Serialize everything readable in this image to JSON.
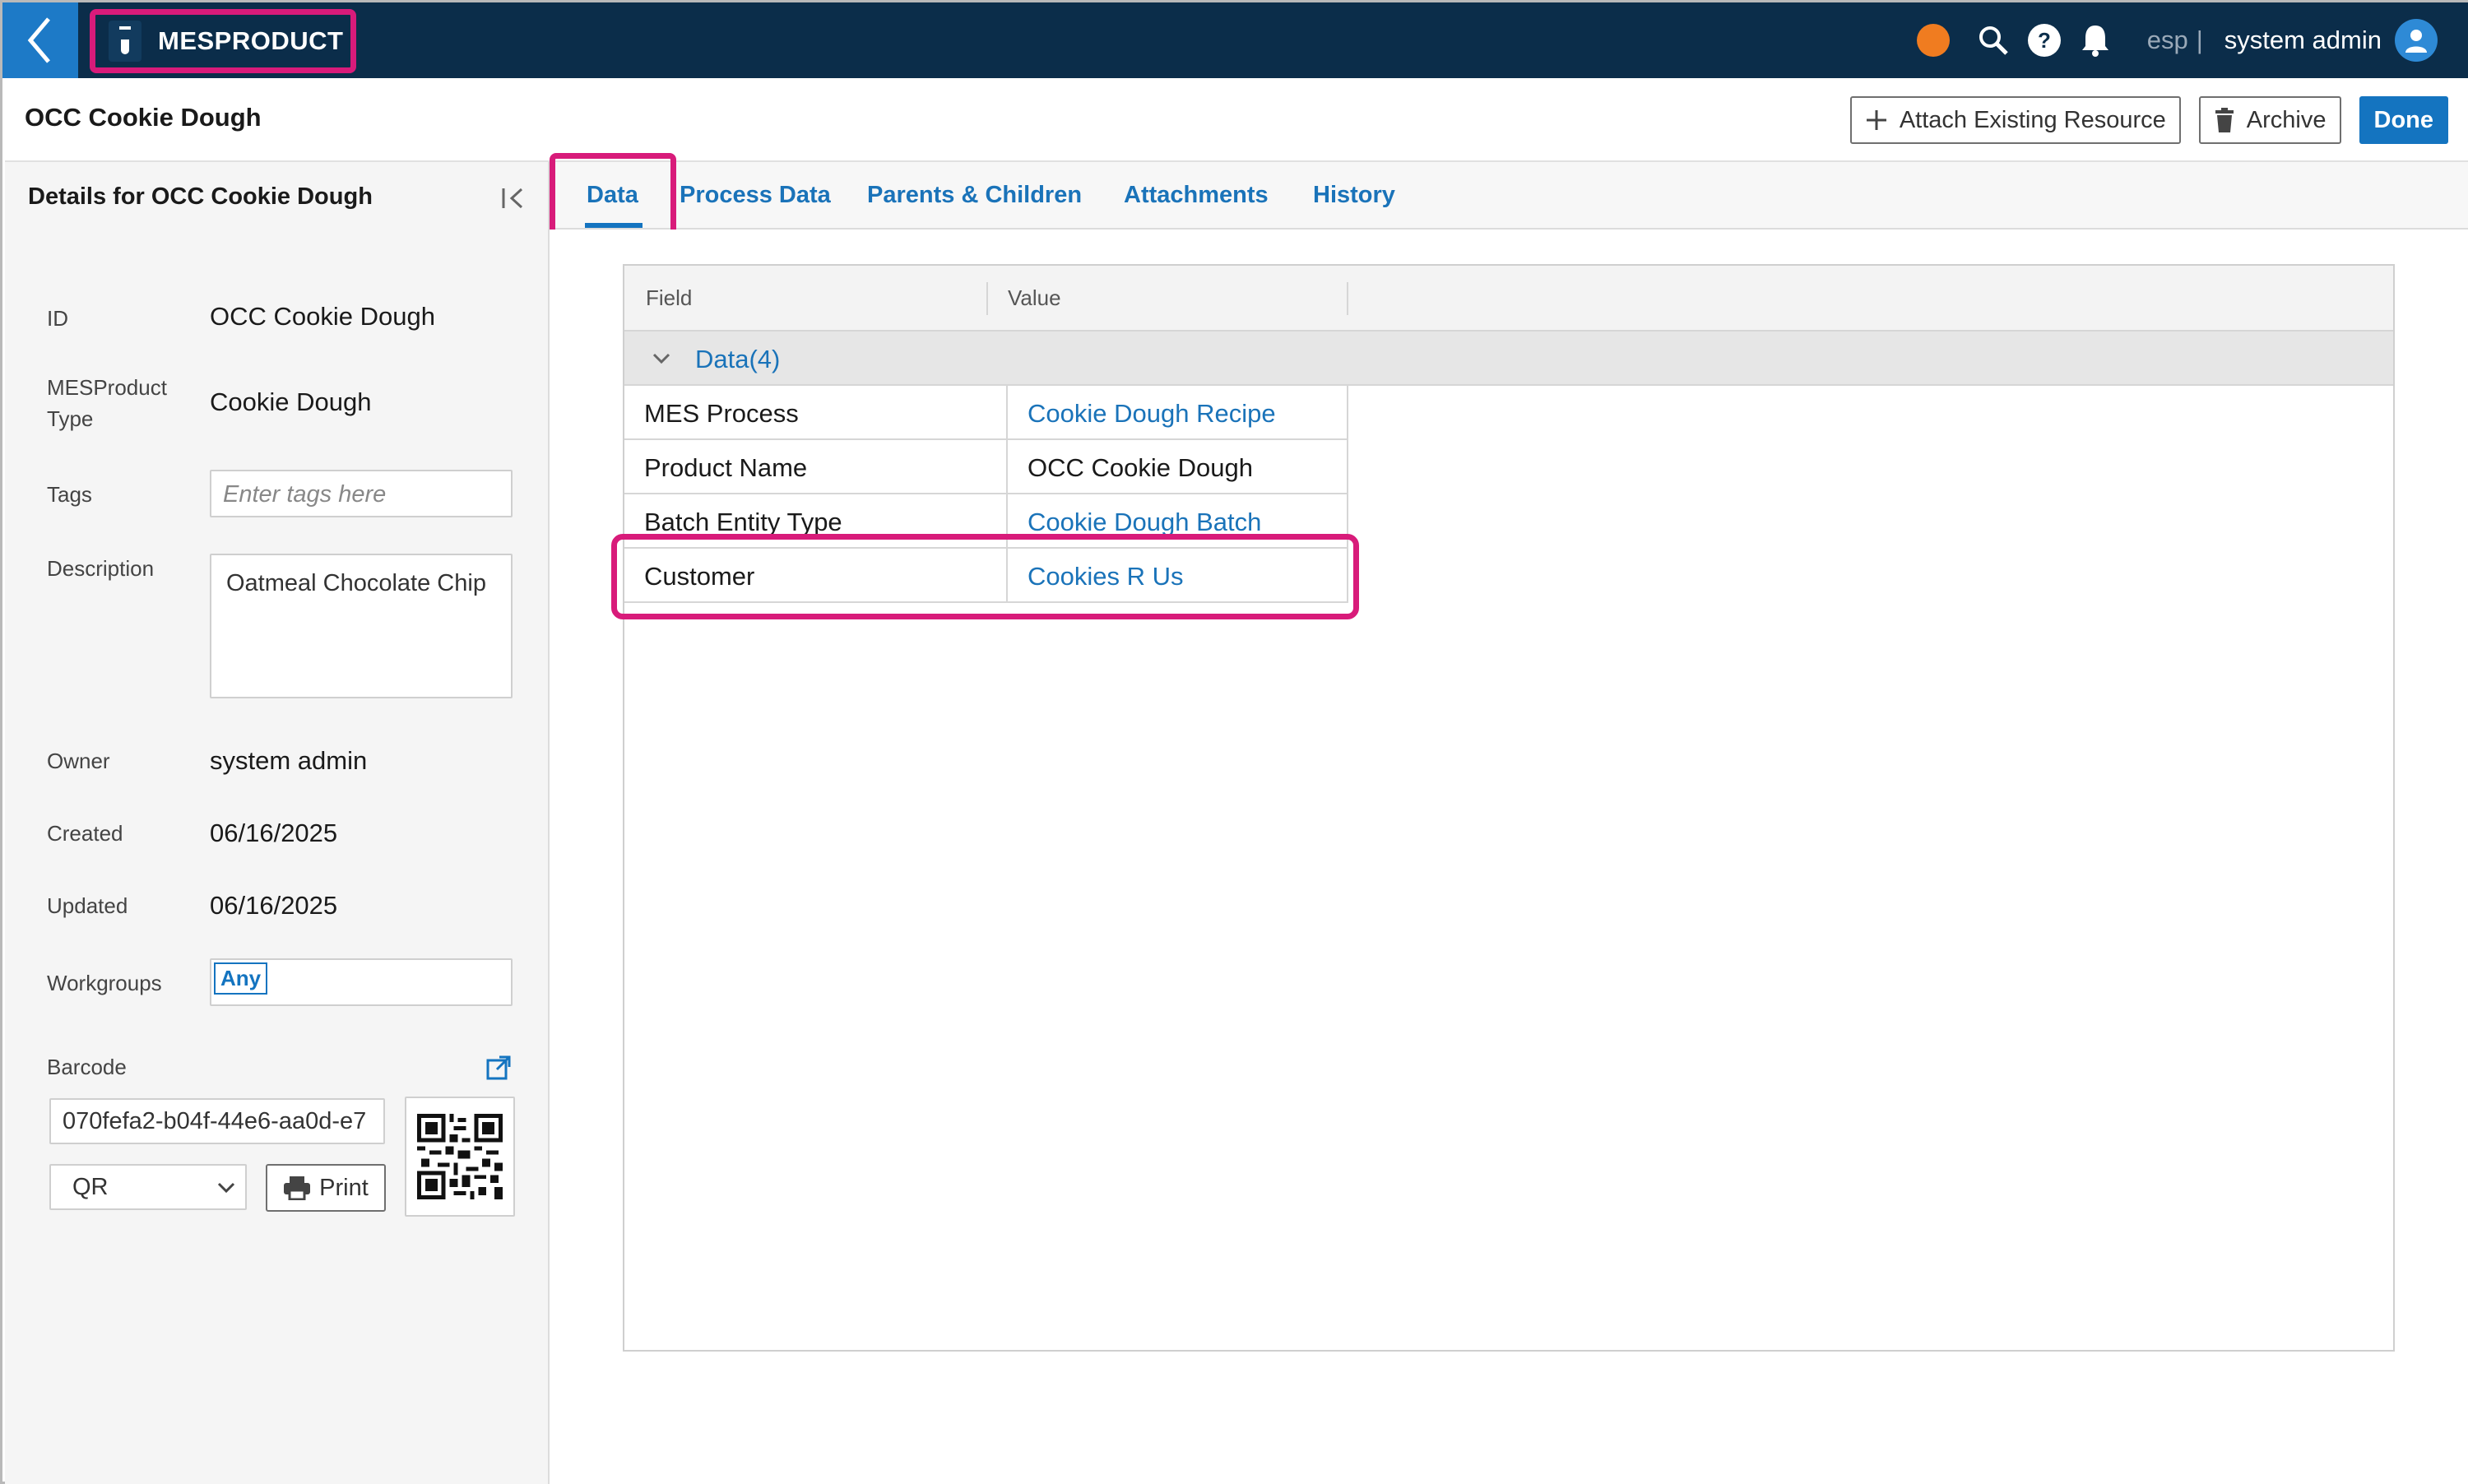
{
  "topbar": {
    "brand": "MESPRODUCT",
    "tenant": "esp",
    "separator": "|",
    "username": "system admin"
  },
  "titlebar": {
    "title": "OCC Cookie Dough",
    "attach_label": "Attach Existing Resource",
    "archive_label": "Archive",
    "done_label": "Done"
  },
  "sidebar": {
    "title": "Details for OCC Cookie Dough",
    "id_label": "ID",
    "id_value": "OCC Cookie Dough",
    "type_label_line1": "MESProduct",
    "type_label_line2": "Type",
    "type_value": "Cookie Dough",
    "tags_label": "Tags",
    "tags_placeholder": "Enter tags here",
    "description_label": "Description",
    "description_value": "Oatmeal Chocolate Chip",
    "owner_label": "Owner",
    "owner_value": "system admin",
    "created_label": "Created",
    "created_value": "06/16/2025",
    "updated_label": "Updated",
    "updated_value": "06/16/2025",
    "workgroups_label": "Workgroups",
    "workgroups_chip": "Any",
    "barcode_label": "Barcode",
    "barcode_value": "070fefa2-b04f-44e6-aa0d-e7",
    "barcode_type": "QR",
    "print_label": "Print"
  },
  "tabs": [
    {
      "label": "Data",
      "active": true
    },
    {
      "label": "Process Data",
      "active": false
    },
    {
      "label": "Parents & Children",
      "active": false
    },
    {
      "label": "Attachments",
      "active": false
    },
    {
      "label": "History",
      "active": false
    }
  ],
  "grid": {
    "columns": [
      "Field",
      "Value"
    ],
    "group_label": "Data",
    "group_count": "(4)",
    "rows": [
      {
        "field": "MES Process",
        "value": "Cookie Dough Recipe",
        "link": true
      },
      {
        "field": "Product Name",
        "value": "OCC Cookie Dough",
        "link": false
      },
      {
        "field": "Batch Entity Type",
        "value": "Cookie Dough Batch",
        "link": true
      },
      {
        "field": "Customer",
        "value": "Cookies R Us",
        "link": true
      }
    ]
  },
  "colors": {
    "topbar_bg": "#0b2d4a",
    "accent": "#1474c0",
    "highlight": "#d81b7a",
    "status_dot": "#f07c20"
  }
}
